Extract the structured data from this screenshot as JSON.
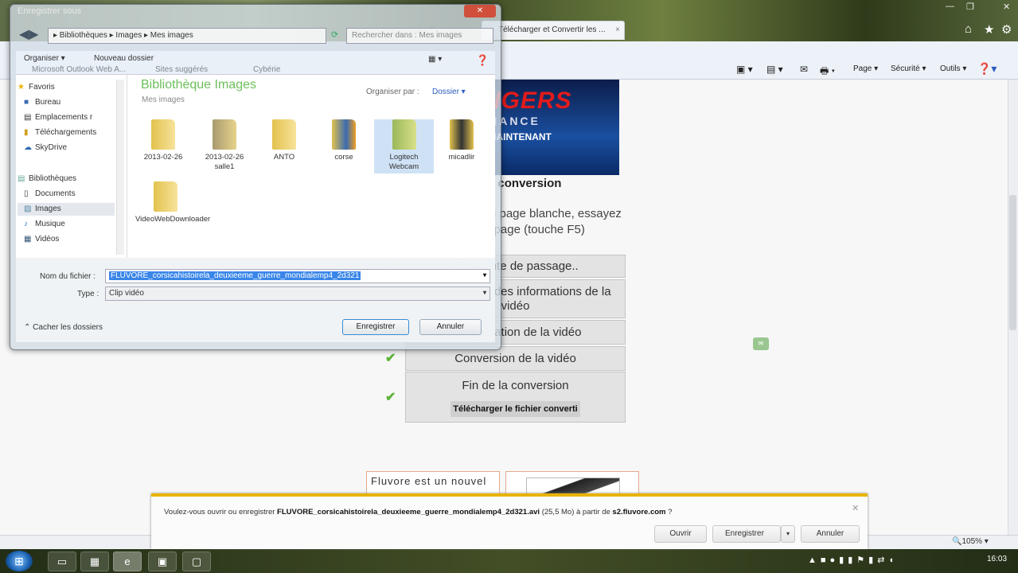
{
  "browser": {
    "tab_title": "Télécharger et Convertir les ...",
    "favorites_bar": [
      "Microsoft Outlook Web A...",
      "Sites suggérés",
      "Cybérie"
    ],
    "command_bar": {
      "page": "Page",
      "security": "Sécurité",
      "tools": "Outils"
    },
    "zoom": "105%"
  },
  "page": {
    "banner": {
      "title": "AVENGERS",
      "subtitle": "ALLIANCE",
      "cta": "JOUEZ MAINTENANT"
    },
    "state_title": "Etat de la conversion",
    "hint": "En cas de blocage ou page blanche, essayez d'actualiser la page (touche F5)",
    "steps": [
      {
        "label": "En attente de passage..",
        "done": true
      },
      {
        "label": "Récupération des informations de la vidéo",
        "done": true
      },
      {
        "label": "Récupération de la vidéo",
        "done": true
      },
      {
        "label": "Conversion de la vidéo",
        "done": true
      },
      {
        "label": "Fin de la conversion",
        "done": true
      }
    ],
    "download_link": "Télécharger le fichier converti",
    "fluvore_text": "Fluvore est un nouvel"
  },
  "download_bar": {
    "prefix": "Voulez-vous ouvrir ou enregistrer",
    "filename": "FLUVORE_corsicahistoirela_deuxieeme_guerre_mondialemp4_2d321.avi",
    "size": "(25,5 Mo) à partir de",
    "host": "s2.fluvore.com",
    "suffix": "?",
    "open": "Ouvrir",
    "save": "Enregistrer",
    "cancel": "Annuler"
  },
  "dialog": {
    "title": "Enregistrer sous",
    "breadcrumb": "▸ Bibliothèques ▸ Images ▸ Mes images",
    "search_placeholder": "Rechercher dans : Mes images",
    "organize": "Organiser ▾",
    "new_folder": "Nouveau dossier",
    "nav": [
      "Favoris",
      "Bureau",
      "Emplacements r",
      "Téléchargements",
      "SkyDrive",
      "Bibliothèques",
      "Documents",
      "Images",
      "Musique",
      "Vidéos"
    ],
    "library_title": "Bibliothèque Images",
    "library_sub": "Mes images",
    "arrange_by": "Organiser par :",
    "arrange_value": "Dossier ▾",
    "folders": [
      "2013-02-26",
      "2013-02-26 salle1",
      "ANTO",
      "corse",
      "Logitech Webcam",
      "micadlir",
      "VideoWebDownloader"
    ],
    "filename_label": "Nom du fichier :",
    "filename_value": "FLUVORE_corsicahistoirela_deuxieeme_guerre_mondialemp4_2d321",
    "type_label": "Type :",
    "type_value": "Clip vidéo",
    "hide_folders": "Cacher les dossiers",
    "save": "Enregistrer",
    "cancel": "Annuler"
  },
  "taskbar": {
    "clock": "16:03"
  }
}
